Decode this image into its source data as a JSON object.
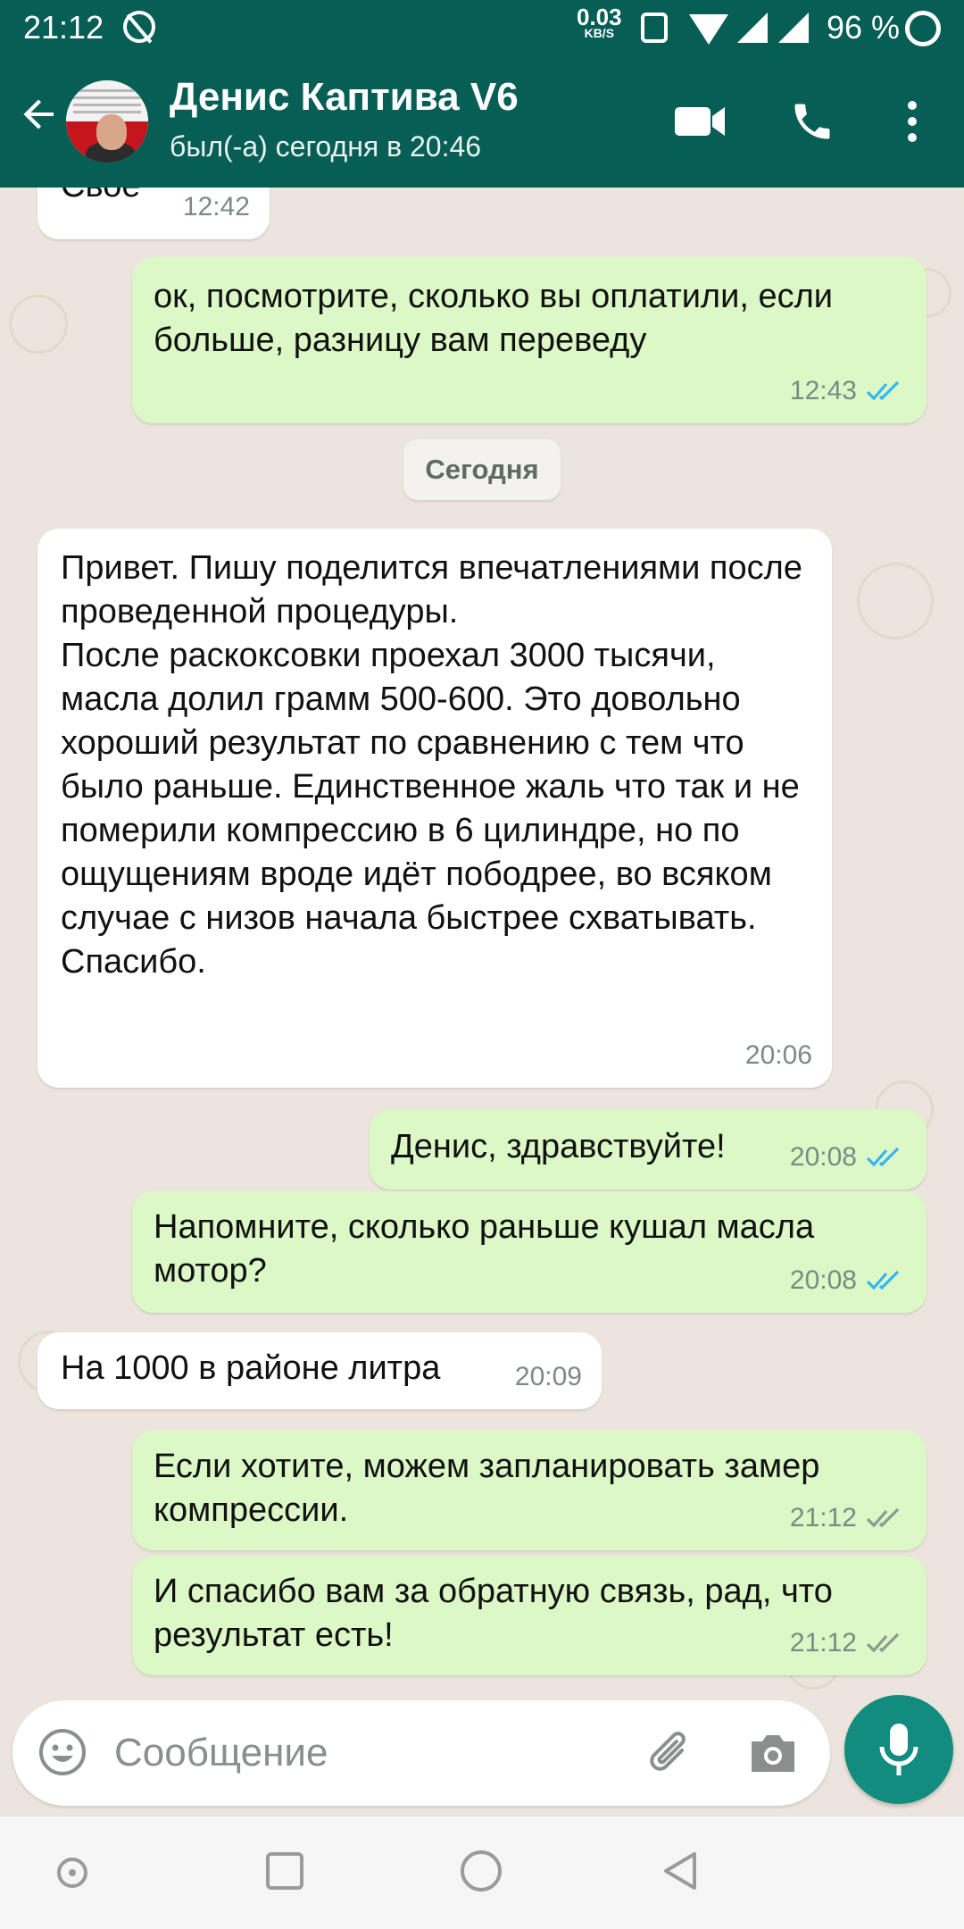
{
  "status_bar": {
    "time": "21:12",
    "net_speed_value": "0.03",
    "net_speed_unit": "KB/S",
    "battery": "96 %"
  },
  "header": {
    "contact_name": "Денис Каптива V6",
    "last_seen": "был(-а) сегодня в 20:46"
  },
  "date_separator": "Сегодня",
  "messages": [
    {
      "direction": "in",
      "text": "Свое",
      "time": "12:42"
    },
    {
      "direction": "out",
      "text": "ок, посмотрите, сколько вы оплатили, если больше, разницу вам переведу",
      "time": "12:43",
      "status": "read"
    },
    {
      "direction": "in",
      "text": "Привет. Пишу поделится впечатлениями после проведенной процедуры.\nПосле раскоксовки проехал 3000 тысячи, масла долил грамм 500-600. Это довольно хороший результат по сравнению с тем что было раньше. Единственное жаль что так и не померили компрессию в 6 цилиндре, но по ощущениям вроде идёт пободрее, во всяком случае с низов начала быстрее схватывать.\nСпасибо.",
      "time": "20:06"
    },
    {
      "direction": "out",
      "text": "Денис, здравствуйте!",
      "time": "20:08",
      "status": "read"
    },
    {
      "direction": "out",
      "text": "Напомните, сколько раньше кушал масла мотор?",
      "time": "20:08",
      "status": "read"
    },
    {
      "direction": "in",
      "text": "На 1000 в районе литра",
      "time": "20:09"
    },
    {
      "direction": "out",
      "text": "Если хотите, можем запланировать замер компрессии.",
      "time": "21:12",
      "status": "delivered"
    },
    {
      "direction": "out",
      "text": "И спасибо вам за обратную связь, рад, что результат есть!",
      "time": "21:12",
      "status": "delivered"
    }
  ],
  "composer": {
    "placeholder": "Сообщение"
  },
  "colors": {
    "header": "#075e54",
    "incoming": "#ffffff",
    "outgoing": "#dcf8c6",
    "read_ticks": "#34b7f1",
    "sent_ticks": "#8c9a94",
    "mic_button": "#128c7e",
    "wallpaper": "#ece5dd"
  },
  "icons": [
    "back-arrow-icon",
    "video-call-icon",
    "voice-call-icon",
    "more-options-icon",
    "emoji-icon",
    "attach-icon",
    "camera-icon",
    "mic-icon"
  ]
}
